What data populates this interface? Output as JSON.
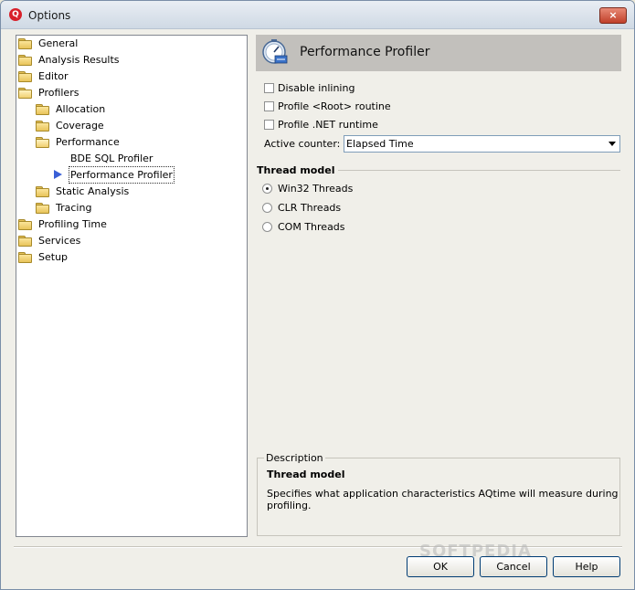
{
  "window": {
    "title": "Options",
    "close_glyph": "×"
  },
  "tree": {
    "items": [
      {
        "label": "General"
      },
      {
        "label": "Analysis Results"
      },
      {
        "label": "Editor"
      },
      {
        "label": "Profilers"
      },
      {
        "label": "Allocation"
      },
      {
        "label": "Coverage"
      },
      {
        "label": "Performance"
      },
      {
        "label": "BDE SQL Profiler"
      },
      {
        "label": "Performance Profiler"
      },
      {
        "label": "Static Analysis"
      },
      {
        "label": "Tracing"
      },
      {
        "label": "Profiling Time"
      },
      {
        "label": "Services"
      },
      {
        "label": "Setup"
      }
    ],
    "selected": "Performance Profiler"
  },
  "panel": {
    "title": "Performance Profiler",
    "icon": "stopwatch-icon",
    "options": {
      "disable_inlining": {
        "label": "Disable inlining",
        "checked": false
      },
      "profile_root": {
        "label": "Profile <Root> routine",
        "checked": false
      },
      "profile_net": {
        "label": "Profile .NET runtime",
        "checked": false
      }
    },
    "active_counter": {
      "label": "Active counter:",
      "value": "Elapsed Time"
    },
    "thread_model": {
      "title": "Thread model",
      "options": [
        {
          "label": "Win32 Threads",
          "checked": true
        },
        {
          "label": "CLR Threads",
          "checked": false
        },
        {
          "label": "COM Threads",
          "checked": false
        }
      ]
    },
    "description": {
      "legend": "Description",
      "title": "Thread model",
      "text": "Specifies what application characteristics AQtime will measure during profiling."
    }
  },
  "buttons": {
    "ok": "OK",
    "cancel": "Cancel",
    "help": "Help"
  },
  "watermark": "SOFTPEDIA"
}
